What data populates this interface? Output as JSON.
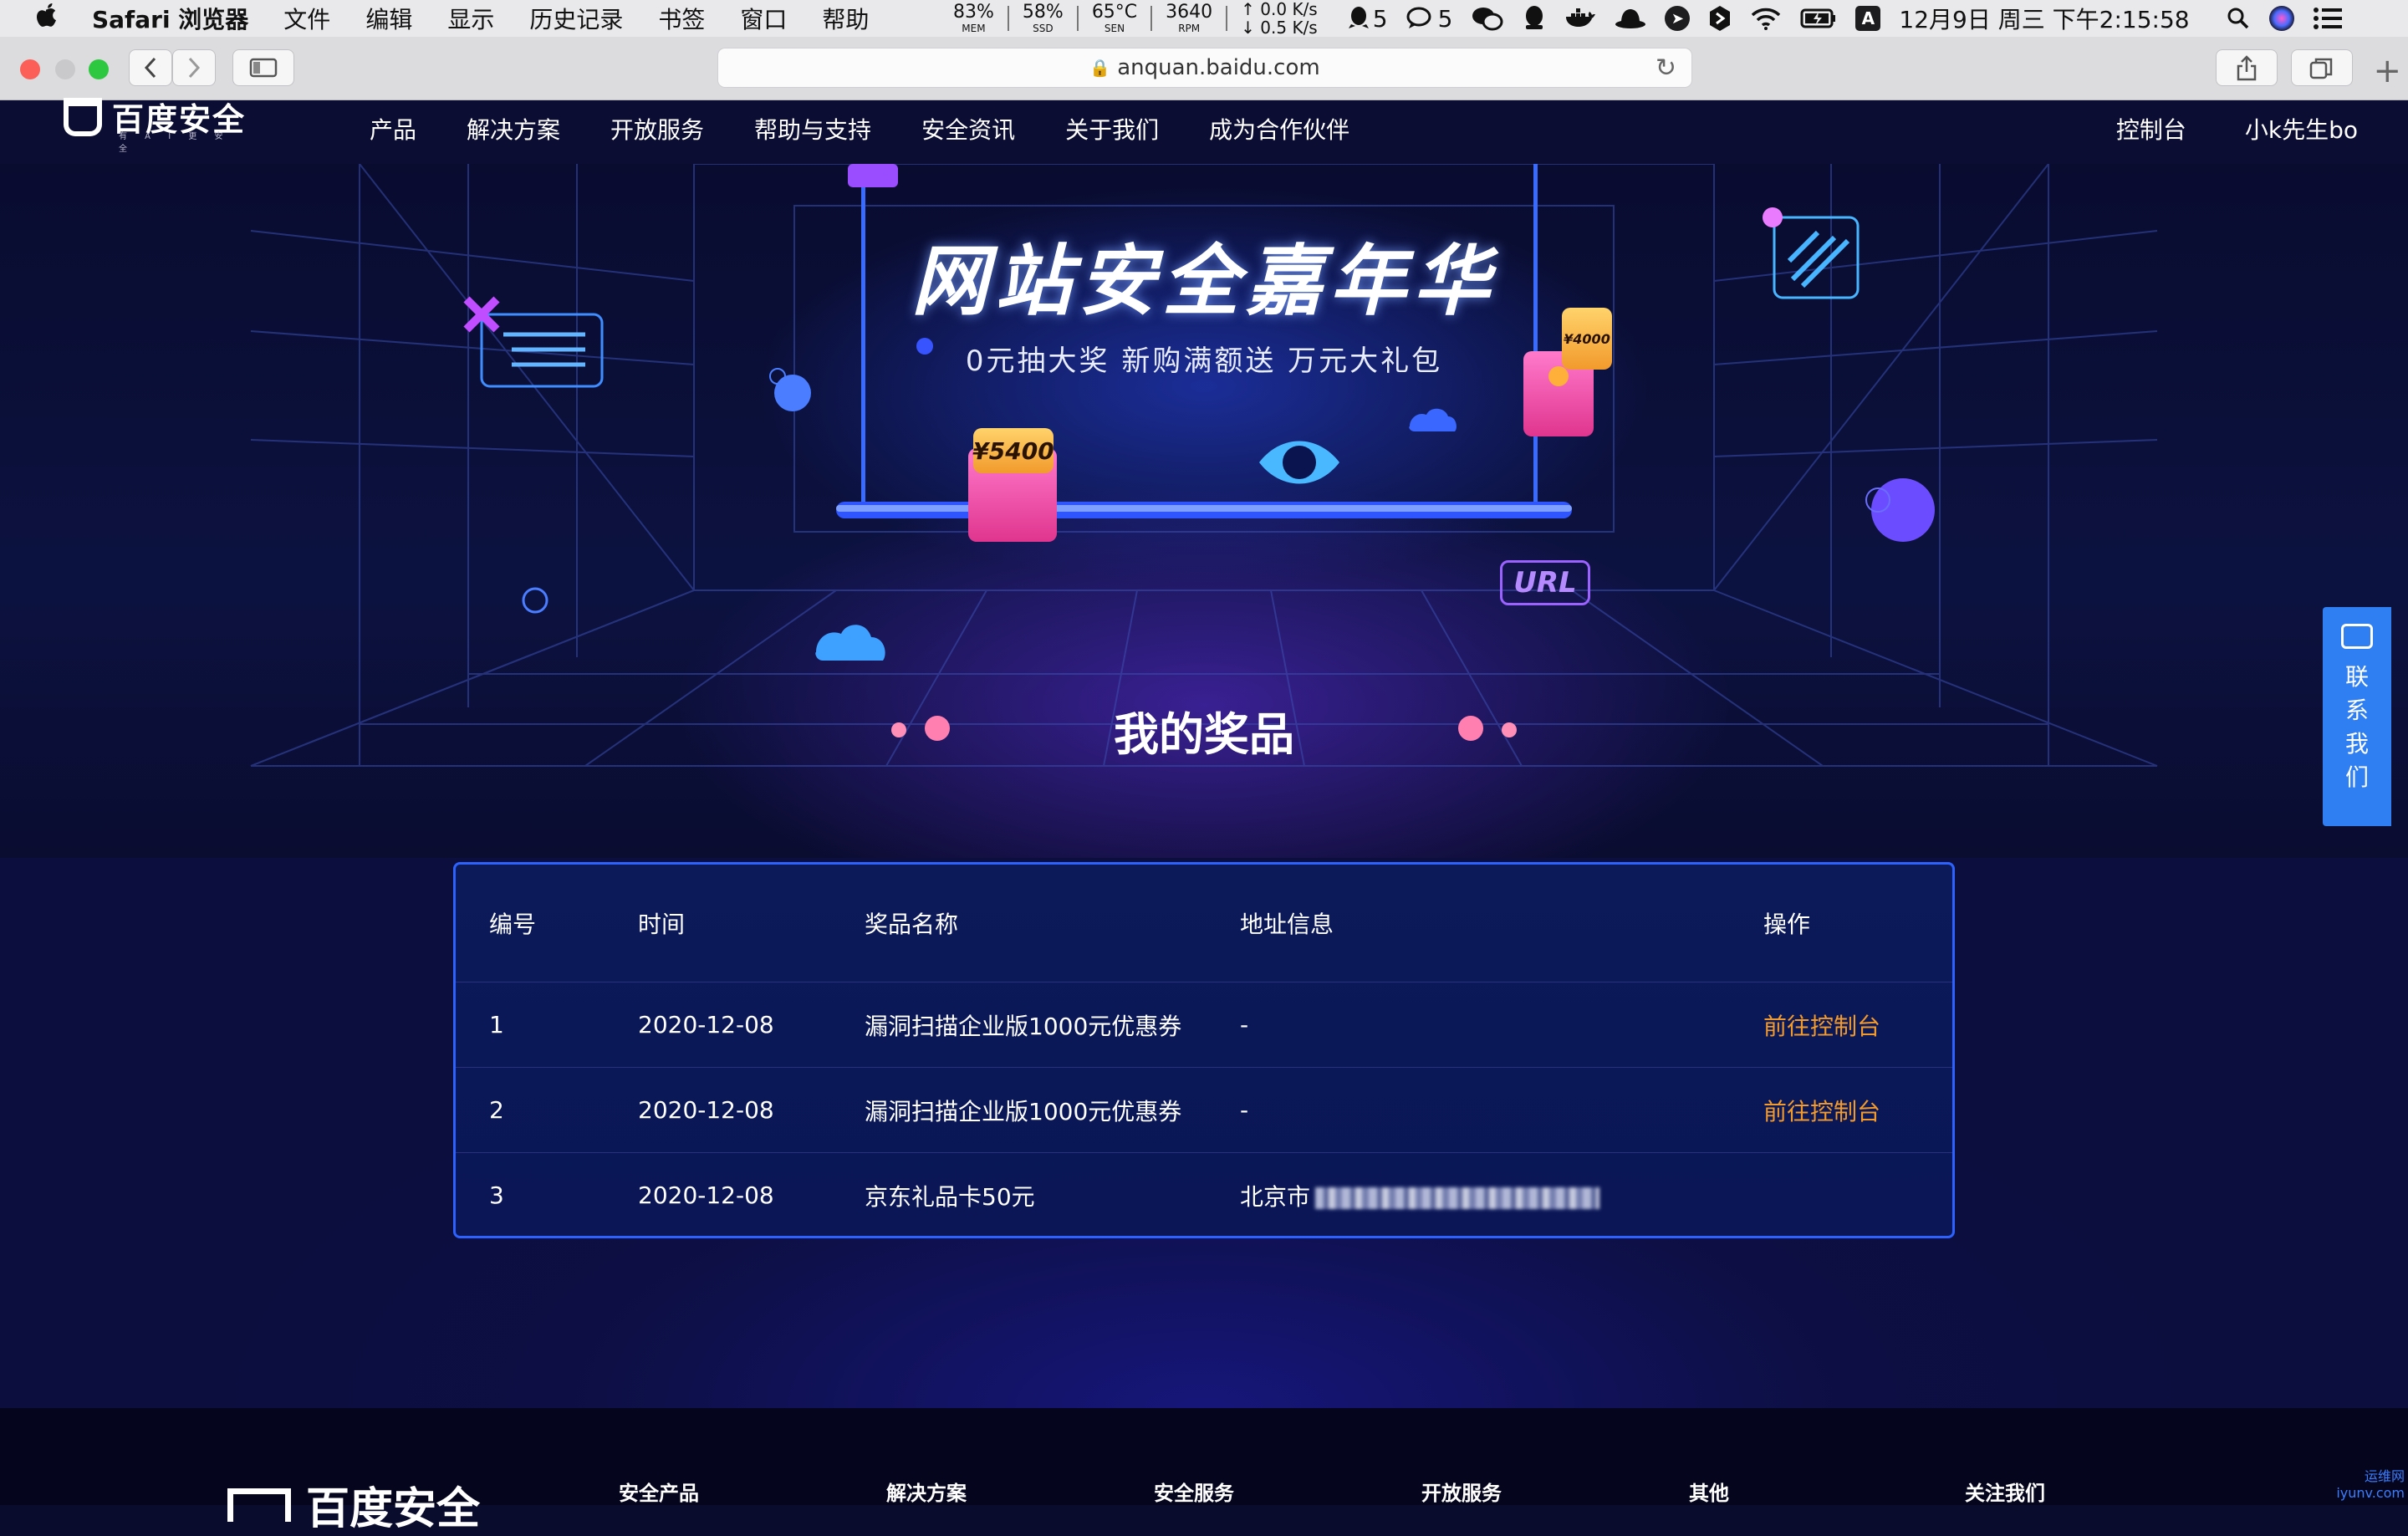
{
  "menubar": {
    "app_name": "Safari 浏览器",
    "items": [
      "文件",
      "编辑",
      "显示",
      "历史记录",
      "书签",
      "窗口",
      "帮助"
    ],
    "stats": [
      {
        "value": "83%",
        "label": "MEM"
      },
      {
        "value": "58%",
        "label": "SSD"
      },
      {
        "value": "65°C",
        "label": "SEN"
      },
      {
        "value": "3640",
        "label": "RPM"
      }
    ],
    "net_up": "↑ 0.0 K/s",
    "net_down": "↓ 0.5 K/s",
    "qq_count": "5",
    "chat_count": "5",
    "input_method": "A",
    "clock": "12月9日 周三 下午2:15:58"
  },
  "browser": {
    "url": "anquan.baidu.com"
  },
  "site": {
    "logo_text": "百度安全",
    "logo_sub": "有 A I 更 安 全",
    "nav": [
      "产品",
      "解决方案",
      "开放服务",
      "帮助与支持",
      "安全资讯",
      "关于我们",
      "成为合作伙伴"
    ],
    "nav_right": [
      "控制台",
      "小k先生bo"
    ]
  },
  "hero": {
    "title": "网站安全嘉年华",
    "subtitle": "0元抽大奖  新购满额送  万元大礼包",
    "ticket_large": "¥5400",
    "ticket_small": "¥4000",
    "url_tag": "URL",
    "section_title": "我的奖品"
  },
  "prizes": {
    "headers": {
      "id": "编号",
      "time": "时间",
      "name": "奖品名称",
      "address": "地址信息",
      "action": "操作"
    },
    "rows": [
      {
        "id": "1",
        "time": "2020-12-08",
        "name": "漏洞扫描企业版1000元优惠券",
        "address": "-",
        "action": "前往控制台"
      },
      {
        "id": "2",
        "time": "2020-12-08",
        "name": "漏洞扫描企业版1000元优惠券",
        "address": "-",
        "action": "前往控制台"
      },
      {
        "id": "3",
        "time": "2020-12-08",
        "name": "京东礼品卡50元",
        "address": "北京市",
        "action": ""
      }
    ]
  },
  "contact": {
    "label": "联系我们"
  },
  "footer": {
    "logo_text": "百度安全",
    "columns": [
      "安全产品",
      "解决方案",
      "安全服务",
      "开放服务",
      "其他",
      "关注我们"
    ],
    "watermark_top": "运维网",
    "watermark_bottom": "iyunv.com"
  },
  "colors": {
    "accent_blue": "#2d62ff",
    "link_orange": "#f39a2c",
    "contact_blue": "#2f7ef2",
    "page_bg": "#0a0c2e"
  }
}
